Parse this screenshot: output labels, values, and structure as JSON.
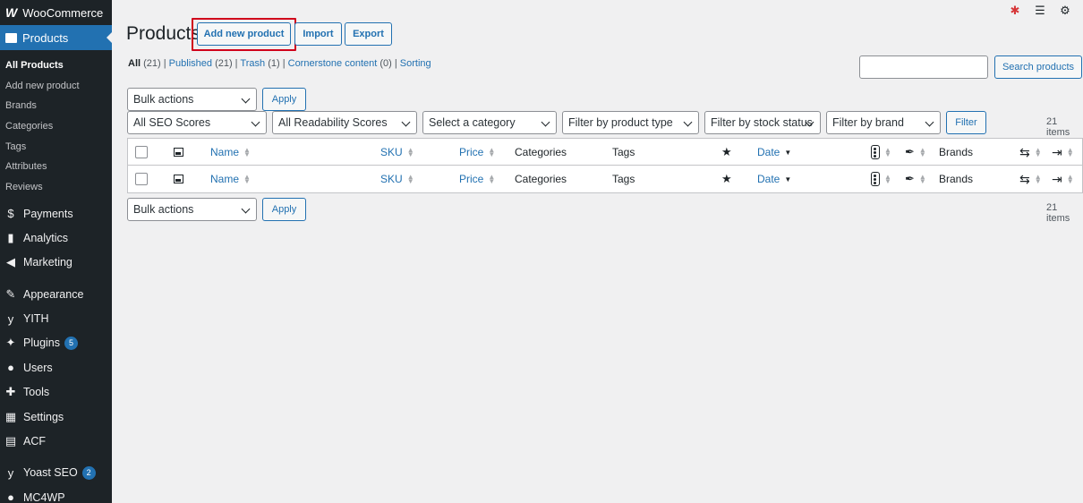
{
  "sidebar": {
    "brand": "WooCommerce",
    "active": "Products",
    "submenu": [
      "All Products",
      "Add new product",
      "Brands",
      "Categories",
      "Tags",
      "Attributes",
      "Reviews"
    ],
    "items": [
      {
        "label": "Payments",
        "icon": "payments-icon",
        "glyph": "$"
      },
      {
        "label": "Analytics",
        "icon": "analytics-icon",
        "glyph": "▮"
      },
      {
        "label": "Marketing",
        "icon": "marketing-icon",
        "glyph": "◀"
      },
      {
        "label": "Appearance",
        "icon": "appearance-icon",
        "glyph": "✎"
      },
      {
        "label": "YITH",
        "icon": "yith-icon",
        "glyph": "y"
      },
      {
        "label": "Plugins",
        "icon": "plugins-icon",
        "glyph": "✦",
        "badge": "5"
      },
      {
        "label": "Users",
        "icon": "users-icon",
        "glyph": "●"
      },
      {
        "label": "Tools",
        "icon": "tools-icon",
        "glyph": "✚"
      },
      {
        "label": "Settings",
        "icon": "settings-icon",
        "glyph": "▦"
      },
      {
        "label": "ACF",
        "icon": "acf-icon",
        "glyph": "▤"
      },
      {
        "label": "Yoast SEO",
        "icon": "yoast-icon",
        "glyph": "y",
        "badge": "2"
      },
      {
        "label": "MC4WP",
        "icon": "mc4wp-icon",
        "glyph": "●"
      }
    ]
  },
  "header": {
    "title": "Products",
    "add_new": "Add new product",
    "import": "Import",
    "export": "Export"
  },
  "filters_links": {
    "all": "All",
    "all_count": "(21)",
    "published": "Published",
    "published_count": "(21)",
    "trash": "Trash",
    "trash_count": "(1)",
    "cornerstone": "Cornerstone content",
    "cornerstone_count": "(0)",
    "sorting": "Sorting"
  },
  "search": {
    "button": "Search products",
    "value": ""
  },
  "bulk": {
    "label": "Bulk actions",
    "apply": "Apply"
  },
  "dropdowns": {
    "seo": "All SEO Scores",
    "readability": "All Readability Scores",
    "category": "Select a category",
    "product_type": "Filter by product type",
    "stock": "Filter by stock status",
    "brand": "Filter by brand",
    "filter_button": "Filter"
  },
  "items_count": "21 items",
  "columns": {
    "name": "Name",
    "sku": "SKU",
    "price": "Price",
    "categories": "Categories",
    "tags": "Tags",
    "date": "Date",
    "brands": "Brands"
  }
}
